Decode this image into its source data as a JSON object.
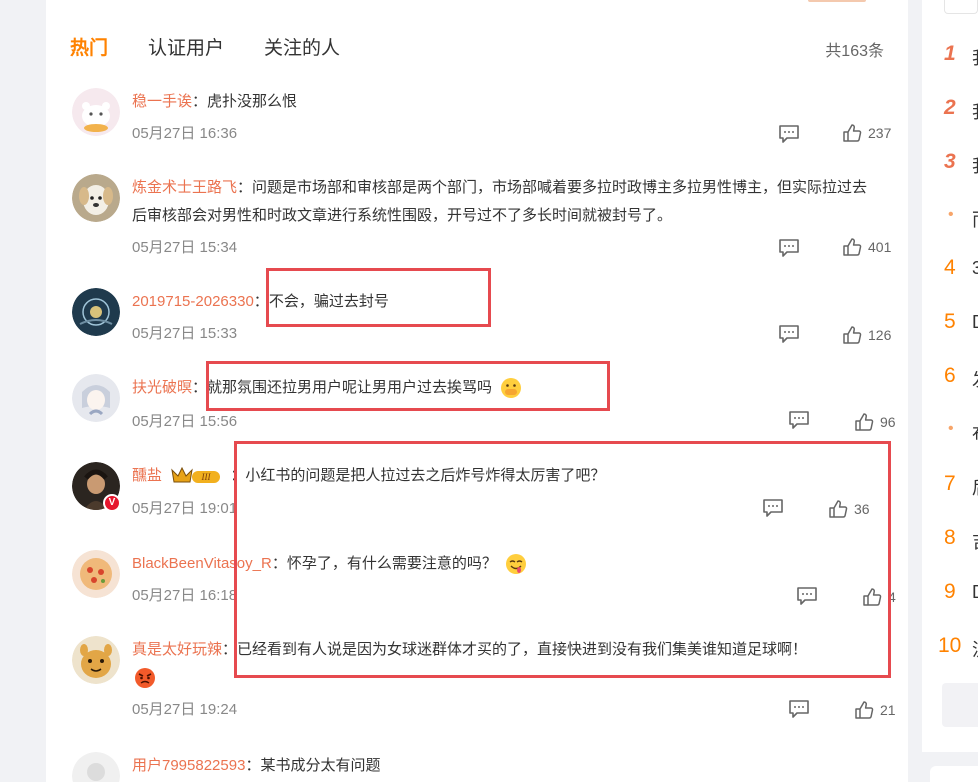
{
  "tabs": {
    "hot": "热门",
    "verified": "认证用户",
    "following": "关注的人"
  },
  "total": "共163条",
  "comments": [
    {
      "user": "稳一手诶",
      "text": "虎扑没那么恨",
      "time": "05月27日 16:36",
      "likes": "237"
    },
    {
      "user": "炼金术士王路飞",
      "text": "问题是市场部和审核部是两个部门，市场部喊着要多拉时政博主多拉男性博主，但实际拉过去后审核部会对男性和时政文章进行系统性围殴，开号过不了多长时间就被封号了。",
      "time": "05月27日 15:34",
      "likes": "401"
    },
    {
      "user": "2019715-2026330",
      "text": "不会，骗过去封号",
      "time": "05月27日 15:33",
      "likes": "126"
    },
    {
      "user": "扶光破暝",
      "text": "就那氛围还拉男用户呢让男用户过去挨骂吗",
      "time": "05月27日 15:56",
      "likes": "96"
    },
    {
      "user": "醺盐",
      "text": "小红书的问题是把人拉过去之后炸号炸得太厉害了吧？",
      "time": "05月27日 19:01",
      "likes": "36"
    },
    {
      "user": "BlackBeenVitasoy_R",
      "text": "怀孕了，有什么需要注意的吗？",
      "time": "05月27日 16:18",
      "likes": "4"
    },
    {
      "user": "真是太好玩辣",
      "text": "已经看到有人说是因为女球迷群体才买的了，直接快进到没有我们集美谁知道足球啊！",
      "time": "05月27日 19:24",
      "likes": "21"
    },
    {
      "user": "用户7995822593",
      "text": "某书成分太有问题"
    }
  ],
  "colon": "：",
  "sidebar": {
    "ranks": [
      "1",
      "2",
      "3",
      "•",
      "4",
      "5",
      "6",
      "•",
      "7",
      "8",
      "9",
      "10"
    ],
    "titles": [
      "我",
      "我",
      "我",
      "而",
      "3",
      "D",
      "发",
      "布",
      "后",
      "吉",
      "D",
      "流"
    ]
  }
}
